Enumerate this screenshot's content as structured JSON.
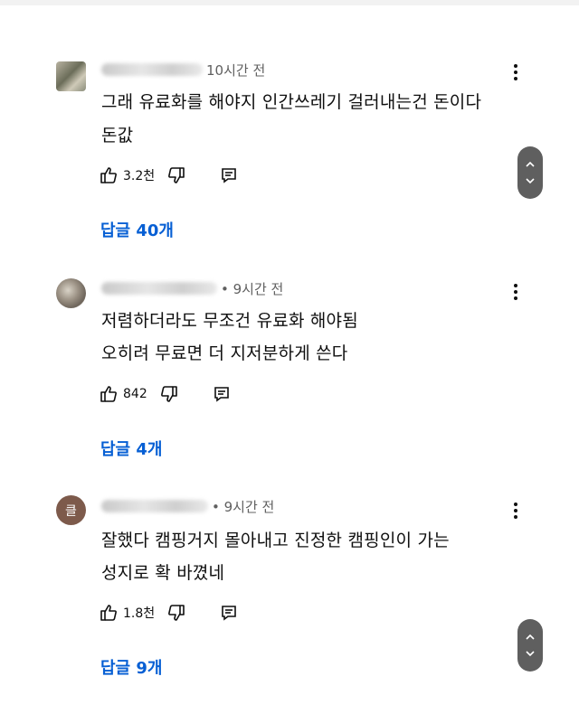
{
  "comments": [
    {
      "author": "",
      "time": "10시간 전",
      "lines": [
        "그래 유료화를 해야지 인간쓰레기 걸러내는건 돈이다",
        "돈값"
      ],
      "likes": "3.2천",
      "reply_label": "답글 40개"
    },
    {
      "author": "",
      "time": "• 9시간 전",
      "lines": [
        "저렴하더라도 무조건 유료화 해야됨",
        "오히려 무료면 더 지저분하게 쓴다"
      ],
      "likes": "842",
      "reply_label": "답글 4개"
    },
    {
      "author": "",
      "avatar_letter": "클",
      "time": "• 9시간 전",
      "lines": [
        "잘했다 캠핑거지 몰아내고 진정한 캠핑인이 가는",
        "성지로 확 바꼈네"
      ],
      "likes": "1.8천",
      "reply_label": "답글 9개"
    }
  ],
  "icons": {
    "like": "thumbs-up-icon",
    "dislike": "thumbs-down-icon",
    "reply": "reply-icon",
    "more": "more-vert-icon",
    "scroll": "scroll-up-down-icon"
  },
  "colors": {
    "link": "#065fd4",
    "meta": "#606060",
    "text": "#0f0f0f",
    "scroll_pill": "#5f5f5f"
  }
}
